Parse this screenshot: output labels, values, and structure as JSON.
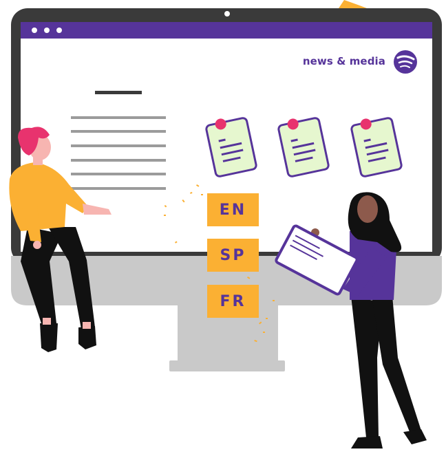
{
  "header": {
    "brand_label": "news & media",
    "brand_icon": "spotify-icon"
  },
  "languages": [
    {
      "code": "EN"
    },
    {
      "code": "SP"
    },
    {
      "code": "FR"
    }
  ],
  "icons": {
    "window_dots": "window-dots-icon",
    "notes": "pinned-note-icon",
    "document": "document-icon"
  },
  "colors": {
    "purple": "#56349a",
    "orange": "#fbb033",
    "monitor": "#3a3a3a",
    "stand": "#c9c9c9",
    "note": "#e6f7cf",
    "pin": "#e8336e",
    "text_lines": "#9b9b9b"
  }
}
